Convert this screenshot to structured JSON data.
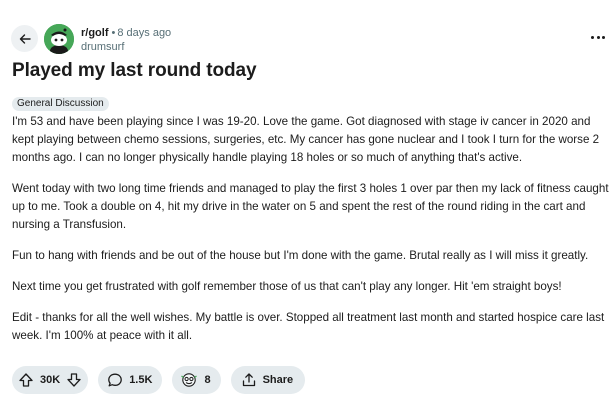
{
  "post": {
    "subreddit": "r/golf",
    "separator": "•",
    "time_ago": "8 days ago",
    "author": "drumsurf",
    "title": "Played my last round today",
    "flair": "General Discussion",
    "paragraphs": [
      "I'm 53 and have been playing since I was 19-20. Love the game. Got diagnosed with stage iv cancer in 2020 and kept playing between chemo sessions, surgeries, etc. My cancer has gone nuclear and I took I turn for the worse 2 months ago. I can no longer physically handle playing 18 holes or so much of anything that's active.",
      "Went today with two long time friends and managed to play the first 3 holes 1 over par then my lack of fitness caught up to me. Took a double on 4, hit my drive in the water on 5 and spent the rest of the round riding in the cart and nursing a Transfusion.",
      "Fun to hang with friends and be out of the house but I'm done with the game. Brutal really as I will miss it greatly.",
      "Next time you get frustrated with golf remember those of us that can't play any longer. Hit 'em straight boys!",
      "Edit - thanks for all the well wishes. My battle is over. Stopped all treatment last month and started hospice care last week. I'm 100% at peace with it all."
    ]
  },
  "actions": {
    "votes": "30K",
    "comments": "1.5K",
    "awards": "8",
    "share_label": "Share"
  },
  "icons": {
    "back": "arrow-left-icon",
    "avatar": "subreddit-avatar",
    "more": "more-horizontal-icon",
    "upvote": "upvote-arrow-icon",
    "downvote": "downvote-arrow-icon",
    "comment": "comment-bubble-icon",
    "award": "award-icon",
    "share": "share-icon"
  },
  "colors": {
    "accent": "#46a758",
    "pill_bg": "#e5ebee",
    "muted_text": "#576f76"
  }
}
